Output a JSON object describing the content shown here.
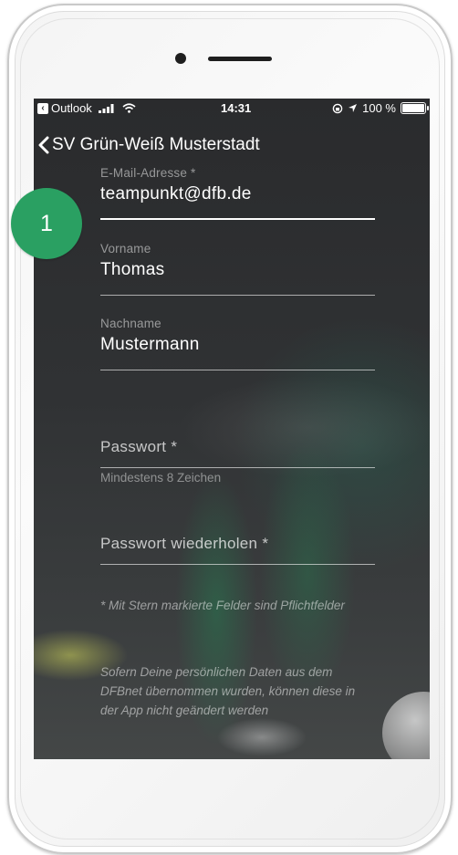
{
  "status_bar": {
    "back_app": "Outlook",
    "time": "14:31",
    "battery": "100 %",
    "battery_level": 1.0
  },
  "nav": {
    "title": "SV Grün-Weiß Musterstadt"
  },
  "form": {
    "email": {
      "label": "E-Mail-Adresse *",
      "value": "teampunkt@dfb.de"
    },
    "firstname": {
      "label": "Vorname",
      "value": "Thomas"
    },
    "lastname": {
      "label": "Nachname",
      "value": "Mustermann"
    },
    "password": {
      "placeholder": "Passwort *",
      "hint": "Mindestens 8 Zeichen"
    },
    "password_repeat": {
      "placeholder": "Passwort wiederholen *"
    },
    "note_required": "* Mit Stern markierte Felder sind Pflichtfelder",
    "note_dfbnet": "Sofern Deine persönlichen Daten aus dem DFBnet übernommen wurden, können diese in der App nicht geändert werden"
  },
  "step_badge": "1",
  "colors": {
    "badge": "#2aa062",
    "screen_bg": "#2b2c2e",
    "text": "#ffffff"
  }
}
